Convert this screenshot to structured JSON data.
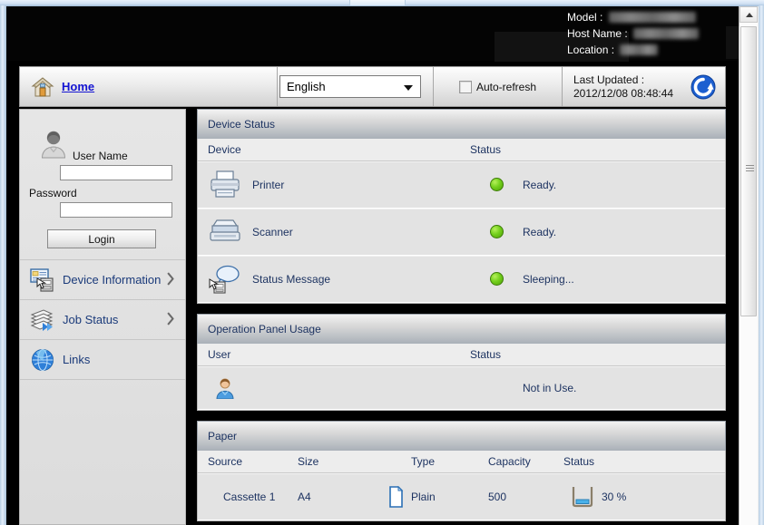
{
  "browser": {
    "scrollbar": {
      "name": "vertical-scrollbar"
    }
  },
  "banner": {
    "fields": [
      {
        "label": "Model :",
        "value": "",
        "redacted": true
      },
      {
        "label": "Host Name :",
        "value": "",
        "redacted": true
      },
      {
        "label": "Location :",
        "value": "",
        "redacted": true
      }
    ]
  },
  "toolbar": {
    "home_label": "Home",
    "language_selected": "English",
    "language_options": [
      "English"
    ],
    "auto_refresh_label": "Auto-refresh",
    "auto_refresh_checked": false,
    "last_updated_label": "Last Updated :",
    "last_updated_value": "2012/12/08 08:48:44",
    "refresh_icon": "refresh-icon"
  },
  "sidebar": {
    "user_name_label": "User Name",
    "user_name_value": "",
    "user_name_placeholder": "",
    "password_label": "Password",
    "password_value": "",
    "password_placeholder": "",
    "login_label": "Login",
    "nav": [
      {
        "label": "Device Information",
        "icon": "device-information-icon",
        "chevron": true
      },
      {
        "label": "Job Status",
        "icon": "job-status-icon",
        "chevron": true
      },
      {
        "label": "Links",
        "icon": "links-globe-icon",
        "chevron": false
      }
    ]
  },
  "panels": {
    "device_status": {
      "title": "Device Status",
      "columns": {
        "device": "Device",
        "status": "Status"
      },
      "rows": [
        {
          "icon": "printer-icon",
          "device": "Printer",
          "indicator": "green",
          "status": "Ready."
        },
        {
          "icon": "scanner-icon",
          "device": "Scanner",
          "indicator": "green",
          "status": "Ready."
        },
        {
          "icon": "status-message-icon",
          "device": "Status Message",
          "indicator": "green",
          "status": "Sleeping..."
        }
      ]
    },
    "operation_panel_usage": {
      "title": "Operation Panel Usage",
      "columns": {
        "user": "User",
        "status": "Status"
      },
      "rows": [
        {
          "icon": "user-avatar-icon",
          "user": "",
          "status": "Not in Use."
        }
      ]
    },
    "paper": {
      "title": "Paper",
      "columns": {
        "source": "Source",
        "size": "Size",
        "type": "Type",
        "capacity": "Capacity",
        "status": "Status"
      },
      "rows": [
        {
          "source": "Cassette 1",
          "size": "A4",
          "type_icon": "paper-sheet-icon",
          "type": "Plain",
          "capacity": "500",
          "status_icon": "paper-tray-level-icon",
          "status": "30 %",
          "level_percent": 30
        }
      ]
    }
  },
  "colors": {
    "link": "#1414d2",
    "panel_text": "#1d3361",
    "status_green": "#74d01d",
    "banner_bg": "#040404"
  }
}
